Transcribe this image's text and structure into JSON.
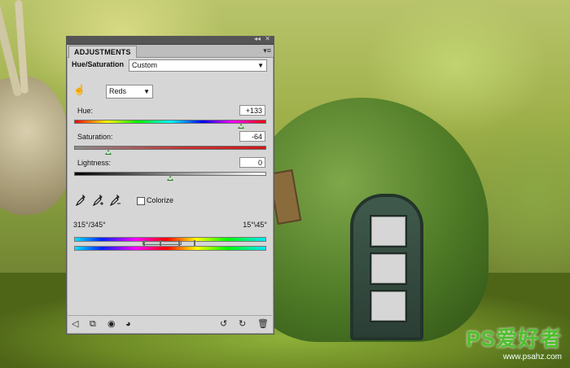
{
  "panel": {
    "tab_label": "ADJUSTMENTS",
    "header_title": "Hue/Saturation",
    "preset_value": "Custom",
    "channel_value": "Reds",
    "hue": {
      "label": "Hue:",
      "value": "+133",
      "level": 0.87
    },
    "saturation": {
      "label": "Saturation:",
      "value": "-64",
      "level": 0.18
    },
    "lightness": {
      "label": "Lightness:",
      "value": "0",
      "level": 0.5
    },
    "colorize_label": "Colorize",
    "colorize_checked": false,
    "range_left_label": "315°/345°",
    "range_right_label": "15°\\45°"
  },
  "icons": {
    "collapse": "double-arrow-icon",
    "close": "close-icon",
    "panel_menu": "panel-menu-icon",
    "targeted_adjust": "hand-targeted-adjustment-icon",
    "eyedropper": "eyedropper-icon",
    "eyedropper_add": "eyedropper-plus-icon",
    "eyedropper_subtract": "eyedropper-minus-icon",
    "back": "back-arrow-icon",
    "expand_view": "expand-view-icon",
    "clip_layer": "clip-to-layer-icon",
    "visibility": "eye-visibility-icon",
    "previous_state": "previous-state-icon",
    "reset": "reset-icon",
    "delete": "trash-icon"
  },
  "watermark": {
    "brand": "PS爱好者",
    "site": "www.psahz.com"
  },
  "colors": {
    "panel_bg": "#d6d6d6",
    "titlebar": "#555555",
    "thumb": "#2c7a2c"
  }
}
